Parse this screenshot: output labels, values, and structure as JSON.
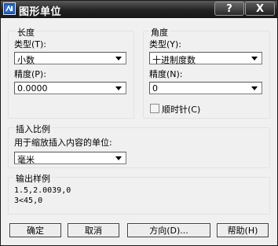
{
  "window": {
    "title": "图形单位",
    "help_button": "?",
    "close_button": "X"
  },
  "length": {
    "group_title": "长度",
    "type_label": "类型(T):",
    "type_value": "小数",
    "precision_label": "精度(P):",
    "precision_value": "0.0000"
  },
  "angle": {
    "group_title": "角度",
    "type_label": "类型(Y):",
    "type_value": "十进制度数",
    "precision_label": "精度(N):",
    "precision_value": "0",
    "clockwise_label": "顺时针(C)",
    "clockwise_checked": false
  },
  "insertion_scale": {
    "group_title": "插入比例",
    "units_label": "用于缩放插入内容的单位:",
    "units_value": "毫米"
  },
  "sample_output": {
    "group_title": "输出样例",
    "line1": "1.5,2.0039,0",
    "line2": "3<45,0"
  },
  "buttons": {
    "ok": "确定",
    "cancel": "取消",
    "direction": "方向(D)...",
    "help": "帮助(H)"
  }
}
